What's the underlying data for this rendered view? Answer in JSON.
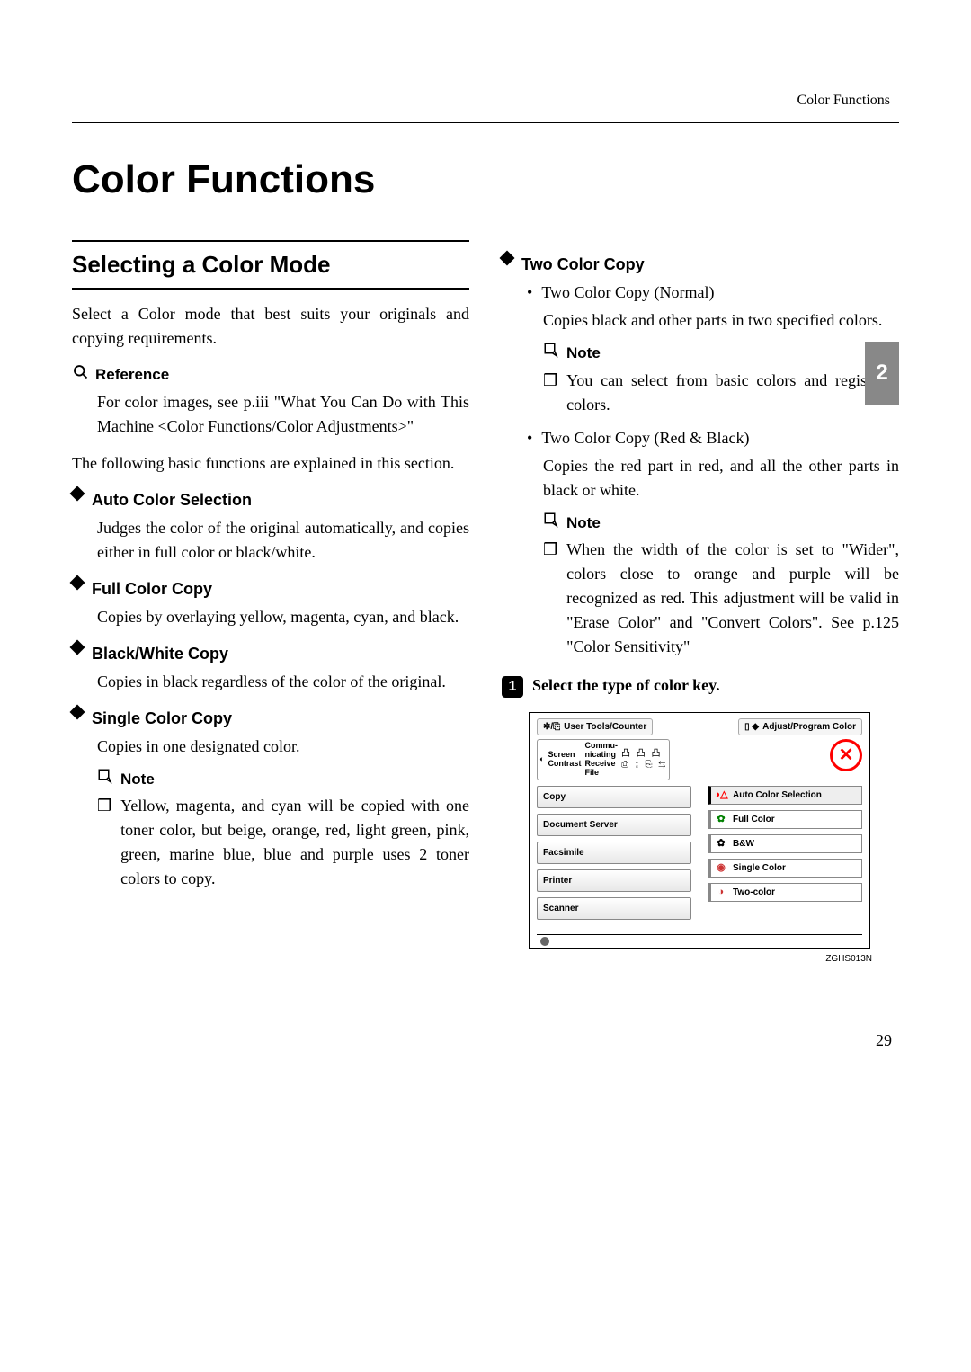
{
  "header": {
    "label": "Color Functions"
  },
  "title": "Color Functions",
  "sidebar_tab": "2",
  "section1": {
    "heading": "Selecting a Color Mode",
    "intro": "Select a Color mode that best suits your originals and copying requirements.",
    "reference": {
      "label": "Reference",
      "body": "For color images, see p.iii \"What You Can Do with This Machine <Color Functions/Color Adjustments>\""
    },
    "intro2": "The following basic functions are explained in this section.",
    "items": {
      "auto": {
        "title": "Auto Color Selection",
        "body": "Judges the color of the original automatically, and copies either in full color or black/white."
      },
      "full": {
        "title": "Full Color Copy",
        "body": "Copies by overlaying yellow, magenta, cyan, and black."
      },
      "bw": {
        "title": "Black/White Copy",
        "body": "Copies in black regardless of the color of the original."
      },
      "single": {
        "title": "Single Color Copy",
        "body": "Copies in one designated color.",
        "note_label": "Note",
        "note_body": "Yellow, magenta, and cyan will be copied with one toner color, but beige, orange, red, light green, pink, green, marine blue, blue and purple uses 2 toner colors to copy."
      },
      "two": {
        "title": "Two Color Copy",
        "normal": {
          "bullet": "Two Color Copy (Normal)",
          "body": "Copies black and other parts in two specified colors.",
          "note_label": "Note",
          "note_body": "You can select from basic colors and registered colors."
        },
        "redblack": {
          "bullet": "Two Color Copy (Red & Black)",
          "body": "Copies the red part in red, and all the other parts in black or white.",
          "note_label": "Note",
          "note_body": "When the width of the color is set to \"Wider\", colors close to orange and purple will be recognized as red. This adjustment will be valid in \"Erase Color\" and \"Convert Colors\". See p.125 \"Color Sensitivity\""
        }
      }
    }
  },
  "step": {
    "number": "1",
    "text": "Select the type of color key."
  },
  "screenshot": {
    "top_left": "User Tools/Counter",
    "top_right": "Adjust/Program Color",
    "status": {
      "screen": "Screen",
      "contrast": "Contrast",
      "commu": "Commu-\nnicating",
      "receive": "Receive\nFile"
    },
    "tabs": [
      "Copy",
      "Document Server",
      "Facsimile",
      "Printer",
      "Scanner"
    ],
    "options": [
      {
        "label": "Auto Color Selection"
      },
      {
        "label": "Full Color"
      },
      {
        "label": "B&W"
      },
      {
        "label": "Single Color"
      },
      {
        "label": "Two-color"
      }
    ],
    "caption": "ZGHS013N"
  },
  "page": "29"
}
